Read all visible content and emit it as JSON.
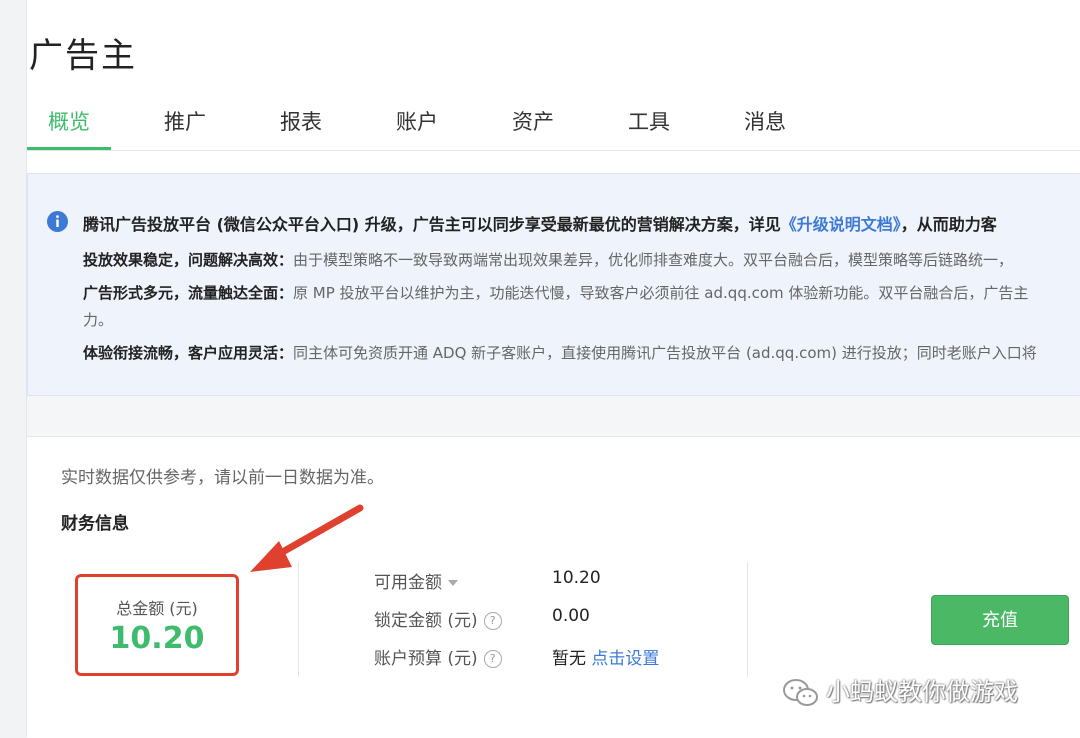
{
  "header": {
    "title": "广告主"
  },
  "tabs": [
    {
      "label": "概览",
      "active": true
    },
    {
      "label": "推广"
    },
    {
      "label": "报表"
    },
    {
      "label": "账户"
    },
    {
      "label": "资产"
    },
    {
      "label": "工具"
    },
    {
      "label": "消息"
    }
  ],
  "notice": {
    "headline_pre": "腾讯广告投放平台 (微信公众平台入口) 升级，广告主可以同步享受最新最优的营销解决方案，详见",
    "headline_link": "《升级说明文档》",
    "headline_post": "，从而助力客",
    "items": [
      {
        "title": "投放效果稳定，问题解决高效：",
        "text": "由于模型策略不一致导致两端常出现效果差异，优化师排查难度大。双平台融合后，模型策略等后链路统一，"
      },
      {
        "title": "广告形式多元，流量触达全面：",
        "text": "原 MP 投放平台以维护为主，功能迭代慢，导致客户必须前往 ad.qq.com 体验新功能。双平台融合后，广告主",
        "wrap": "力。"
      },
      {
        "title": "体验衔接流畅，客户应用灵活：",
        "text": "同主体可免资质开通 ADQ 新子客账户，直接使用腾讯广告投放平台 (ad.qq.com) 进行投放；同时老账户入口将"
      }
    ]
  },
  "finance": {
    "hint": "实时数据仅供参考，请以前一日数据为准。",
    "section_title": "财务信息",
    "total_label": "总金额 (元)",
    "total_value": "10.20",
    "available_label": "可用金额",
    "available_value": "10.20",
    "locked_label": "锁定金额 (元)",
    "locked_value": "0.00",
    "budget_label": "账户预算 (元)",
    "budget_value": "暂无",
    "budget_link": "点击设置",
    "recharge_label": "充值",
    "help_glyph": "?"
  },
  "watermark": {
    "text": "小蚂蚁教你做游戏"
  },
  "colors": {
    "accent": "#3ebb6c",
    "link": "#3d7ad6",
    "highlight": "#e0412f",
    "button": "#4bb866"
  }
}
